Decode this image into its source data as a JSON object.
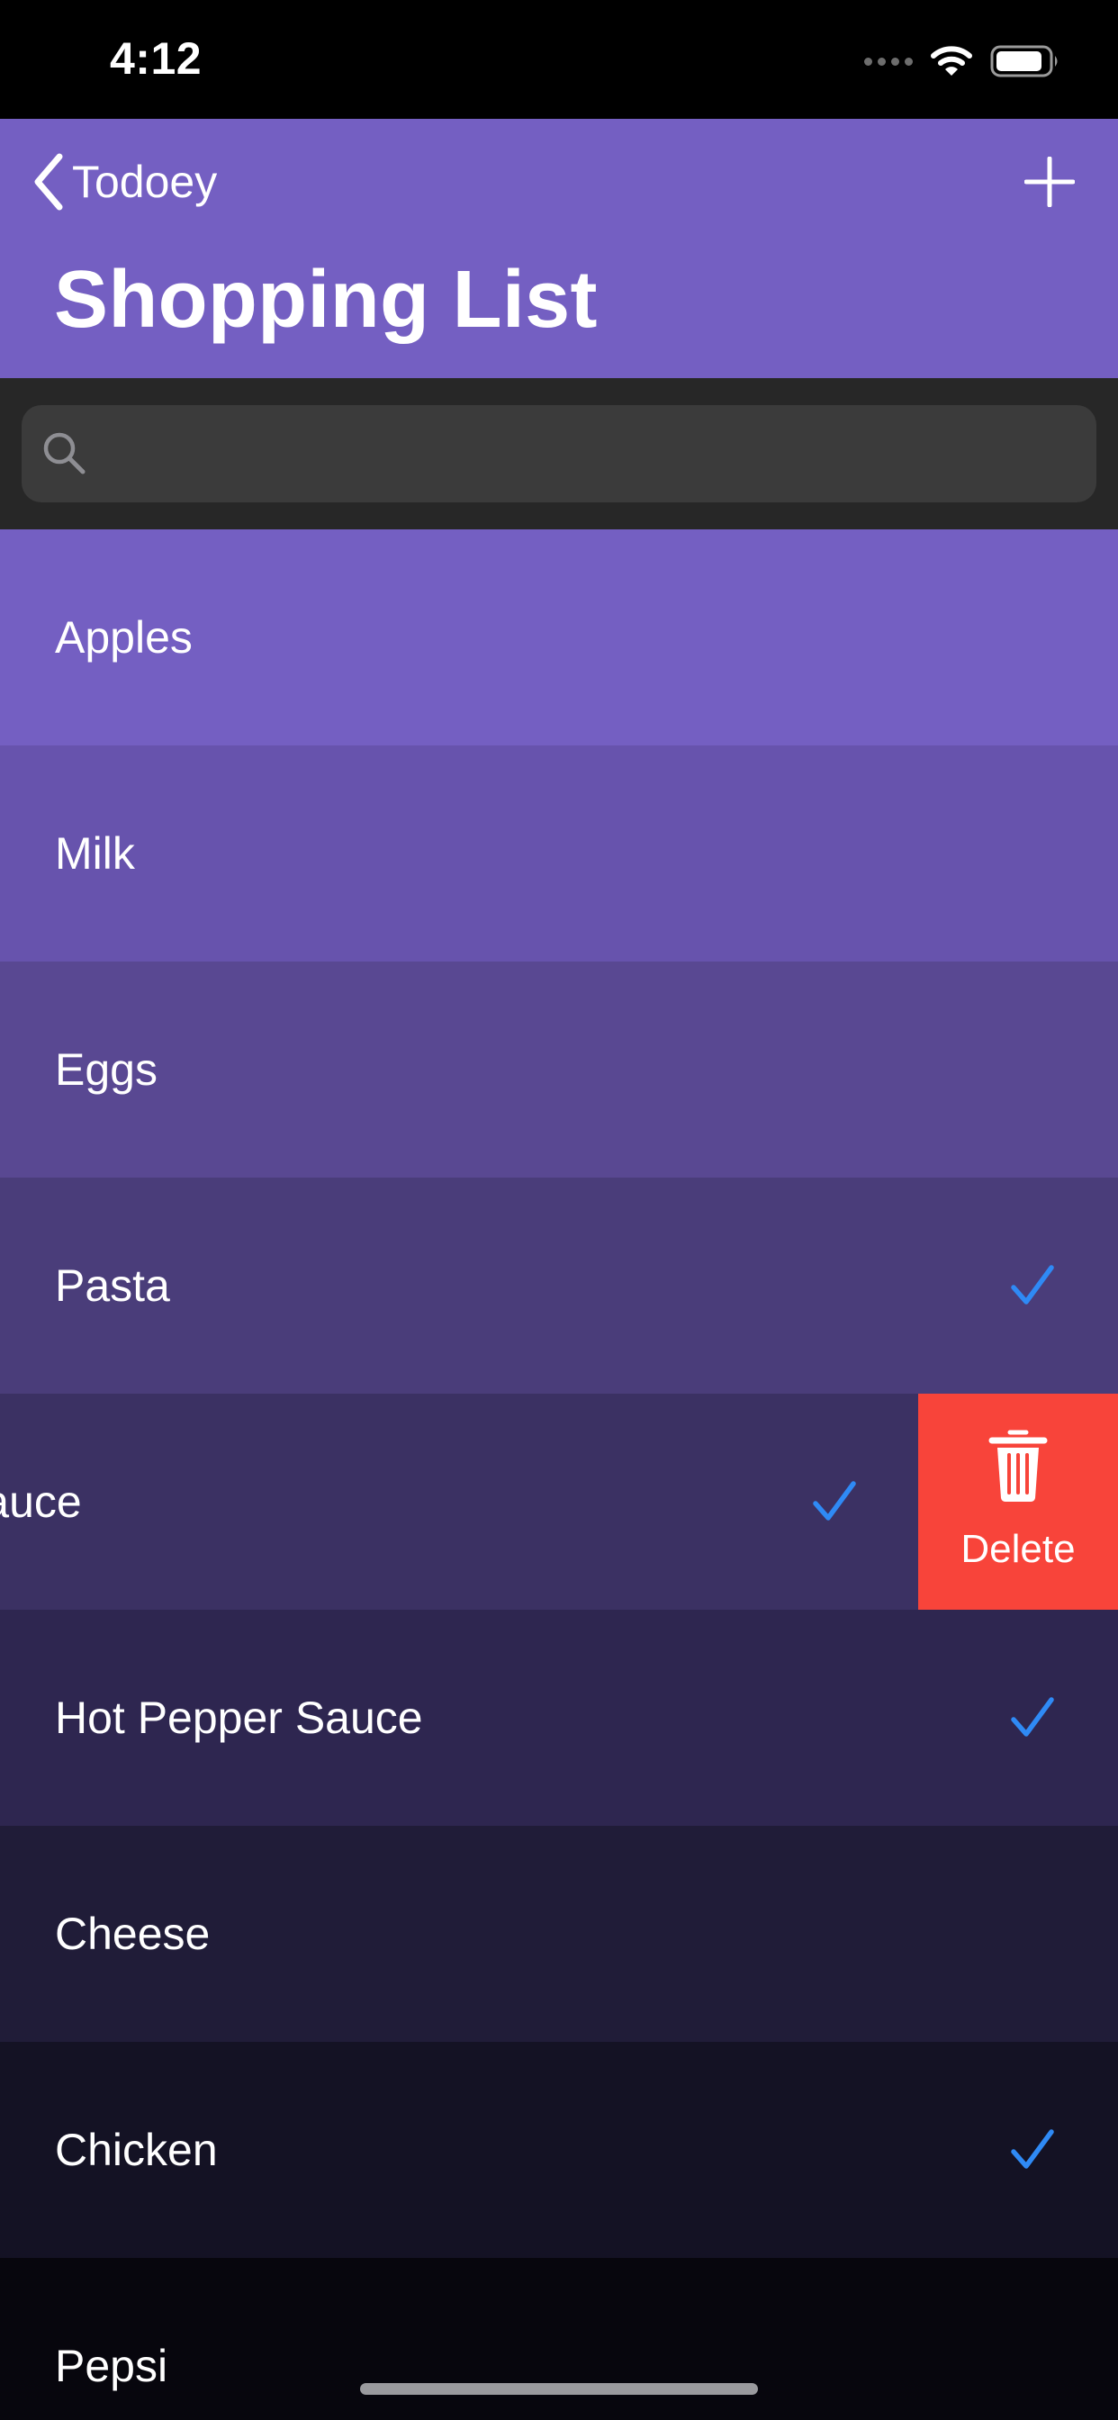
{
  "status_bar": {
    "time": "4:12"
  },
  "nav": {
    "back_label": "Todoey",
    "title": "Shopping List",
    "add_icon": "plus-icon",
    "back_icon": "chevron-left-icon",
    "background_color": "#745fc2"
  },
  "search": {
    "placeholder": "",
    "value": ""
  },
  "list": {
    "items": [
      {
        "label": "Apples",
        "done": false,
        "color": "#745fc2"
      },
      {
        "label": "Milk",
        "done": false,
        "color": "#6753ad"
      },
      {
        "label": "Eggs",
        "done": false,
        "color": "#594892"
      },
      {
        "label": "Pasta",
        "done": true,
        "color": "#4a3d7a"
      },
      {
        "label": "Barbecue Sauce",
        "done": true,
        "color": "#3b3163",
        "swiped": true
      },
      {
        "label": "Hot Pepper Sauce",
        "done": true,
        "color": "#2e2650"
      },
      {
        "label": "Cheese",
        "done": false,
        "color": "#201c38"
      },
      {
        "label": "Chicken",
        "done": true,
        "color": "#141224"
      },
      {
        "label": "Pepsi",
        "done": false,
        "color": "#07060d"
      }
    ],
    "checkmark_color": "#2f8af5",
    "delete_action": {
      "label": "Delete",
      "icon": "trash-icon",
      "color": "#f8443a"
    }
  }
}
